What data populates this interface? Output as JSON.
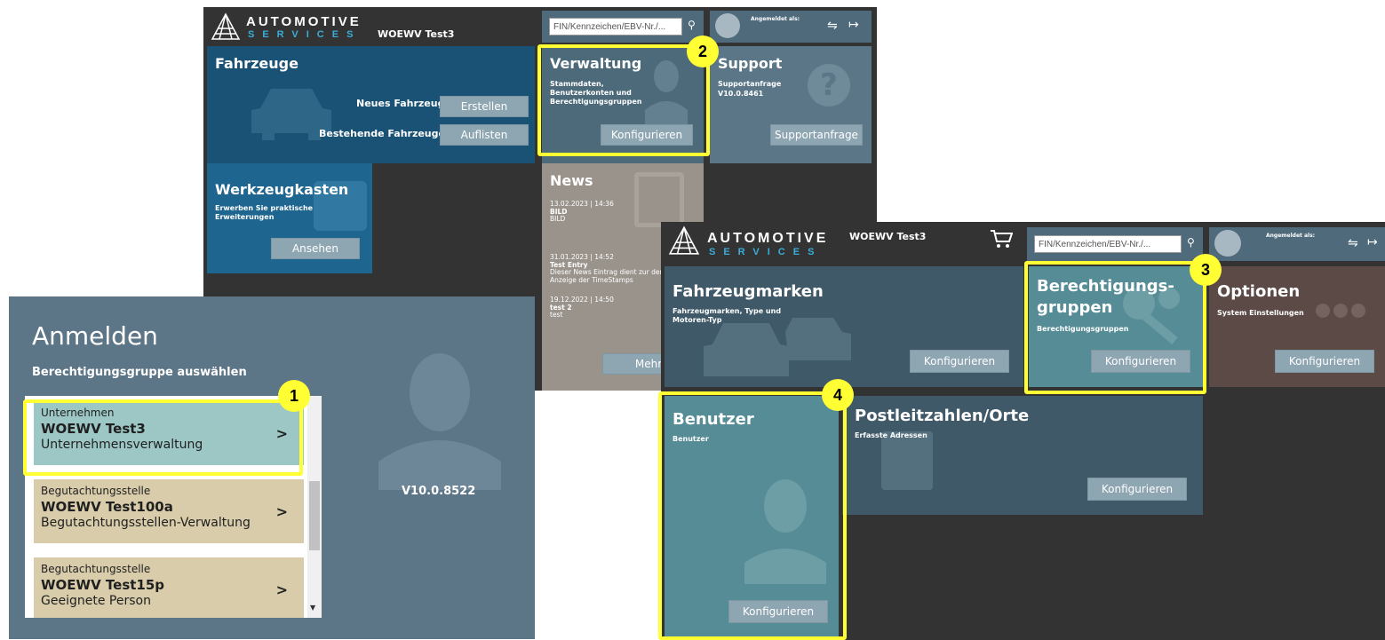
{
  "brand": {
    "line1": "AUTOMOTIVE",
    "line2": "SERVICES"
  },
  "screen_a": {
    "company": "WOEWV Test3",
    "search_placeholder": "FIN/Kennzeichen/EBV-Nr./...",
    "logged_in_label": "Angemeldet als:",
    "fahrzeuge": {
      "title": "Fahrzeuge",
      "new_label": "Neues Fahrzeug",
      "new_btn": "Erstellen",
      "existing_label": "Bestehende Fahrzeuge",
      "existing_btn": "Auflisten"
    },
    "verwaltung": {
      "title": "Verwaltung",
      "subtitle": "Stammdaten, Benutzerkonten und Berechtigungsgruppen",
      "btn": "Konfigurieren"
    },
    "support": {
      "title": "Support",
      "line1": "Supportanfrage",
      "line2": "V10.0.8461",
      "btn": "Supportanfrage"
    },
    "werkzeug": {
      "title": "Werkzeugkasten",
      "subtitle": "Erwerben Sie praktische Erweiterungen",
      "btn": "Ansehen"
    },
    "news": {
      "title": "News",
      "entries": [
        {
          "date": "13.02.2023 | 14:36",
          "title": "BILD",
          "text": "BILD"
        },
        {
          "date": "31.01.2023 | 14:52",
          "title": "Test Entry",
          "text": "Dieser News Eintrag dient zur der Anzeige der TimeStamps"
        },
        {
          "date": "19.12.2022 | 14:50",
          "title": "test 2",
          "text": "test"
        }
      ],
      "more_btn": "Mehr"
    }
  },
  "login": {
    "title": "Anmelden",
    "subtitle": "Berechtigungsgruppe auswählen",
    "version": "V10.0.8522",
    "items": [
      {
        "category": "Unternehmen",
        "name": "WOEWV Test3",
        "role": "Unternehmensverwaltung",
        "color": "#9cc7c5"
      },
      {
        "category": "Begutachtungsstelle",
        "name": "WOEWV Test100a",
        "role": "Begutachtungsstellen-Verwaltung",
        "color": "#d8ccaa"
      },
      {
        "category": "Begutachtungsstelle",
        "name": "WOEWV Test15p",
        "role": "Geeignete Person",
        "color": "#d8ccaa"
      }
    ]
  },
  "screen_b": {
    "company": "WOEWV Test3",
    "search_placeholder": "FIN/Kennzeichen/EBV-Nr./...",
    "logged_in_label": "Angemeldet als:",
    "fahrzeugmarken": {
      "title": "Fahrzeugmarken",
      "subtitle": "Fahrzeugmarken, Type und Motoren-Typ",
      "btn": "Konfigurieren"
    },
    "berechtigung": {
      "title_line1": "Berechtigungs-",
      "title_line2": "gruppen",
      "subtitle": "Berechtigungsgruppen",
      "btn": "Konfigurieren"
    },
    "optionen": {
      "title": "Optionen",
      "subtitle": "System Einstellungen",
      "btn": "Konfigurieren"
    },
    "benutzer": {
      "title": "Benutzer",
      "subtitle": "Benutzer",
      "btn": "Konfigurieren"
    },
    "plz": {
      "title": "Postleitzahlen/Orte",
      "subtitle": "Erfasste Adressen",
      "btn": "Konfigurieren"
    }
  },
  "callouts": [
    "1",
    "2",
    "3",
    "4"
  ],
  "colors": {
    "highlight": "#ffff33",
    "dark_bg": "#333333",
    "blue_tile": "#1a5275",
    "slate_tile": "#4d6a7b",
    "teal_tile": "#558c96",
    "brown_tile": "#5b4a46",
    "news_tile": "#9a938c"
  }
}
